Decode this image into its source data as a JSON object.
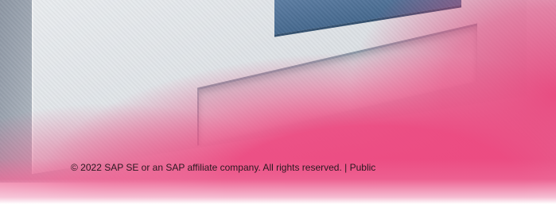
{
  "footer": {
    "copyright": "© 2022 SAP SE or an SAP affiliate company. All rights reserved. | Public"
  },
  "colors": {
    "accent_pink": "#ec4a81",
    "monitor_gray": "#dde1e5",
    "screen_blue": "#46698f"
  }
}
